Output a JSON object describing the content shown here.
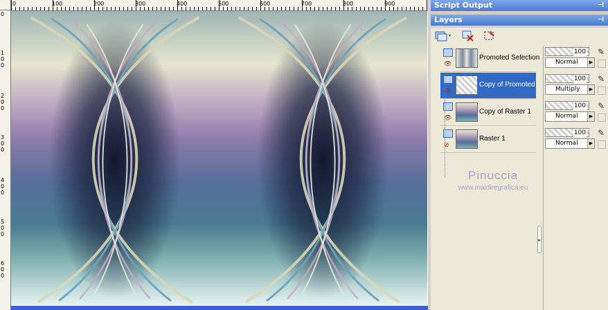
{
  "ruler": {
    "top_labels": [
      "0",
      "100",
      "200",
      "300",
      "400",
      "500",
      "600",
      "700",
      "800",
      "900"
    ],
    "left_labels": [
      "0",
      "1",
      "0",
      "0",
      "2",
      "0",
      "0",
      "3",
      "0",
      "0",
      "4",
      "0",
      "0",
      "5",
      "0",
      "0",
      "6",
      "0",
      "0"
    ]
  },
  "panels": {
    "script_output": {
      "title": "Script Output"
    },
    "layers": {
      "title": "Layers"
    }
  },
  "layers": [
    {
      "name": "Promoted Selection",
      "opacity": "100",
      "blend": "Normal",
      "selected": false
    },
    {
      "name": "Copy of Promoted",
      "opacity": "100",
      "blend": "Multiply",
      "selected": true
    },
    {
      "name": "Copy of Raster 1",
      "opacity": "100",
      "blend": "Normal",
      "selected": false
    },
    {
      "name": "Raster 1",
      "opacity": "100",
      "blend": "Normal",
      "selected": false
    }
  ],
  "watermark": {
    "name": "Pinuccia",
    "url": "www.maidiregrafica.eu"
  },
  "icons": {
    "pin": "pin-icon",
    "new_layer": "new-layer-icon",
    "delete_layer": "delete-layer-icon",
    "edit_selection": "edit-selection-icon"
  },
  "colors": {
    "title_bar": "#4c79d0",
    "selection": "#316ac5",
    "panel_bg": "#ece9d8"
  }
}
